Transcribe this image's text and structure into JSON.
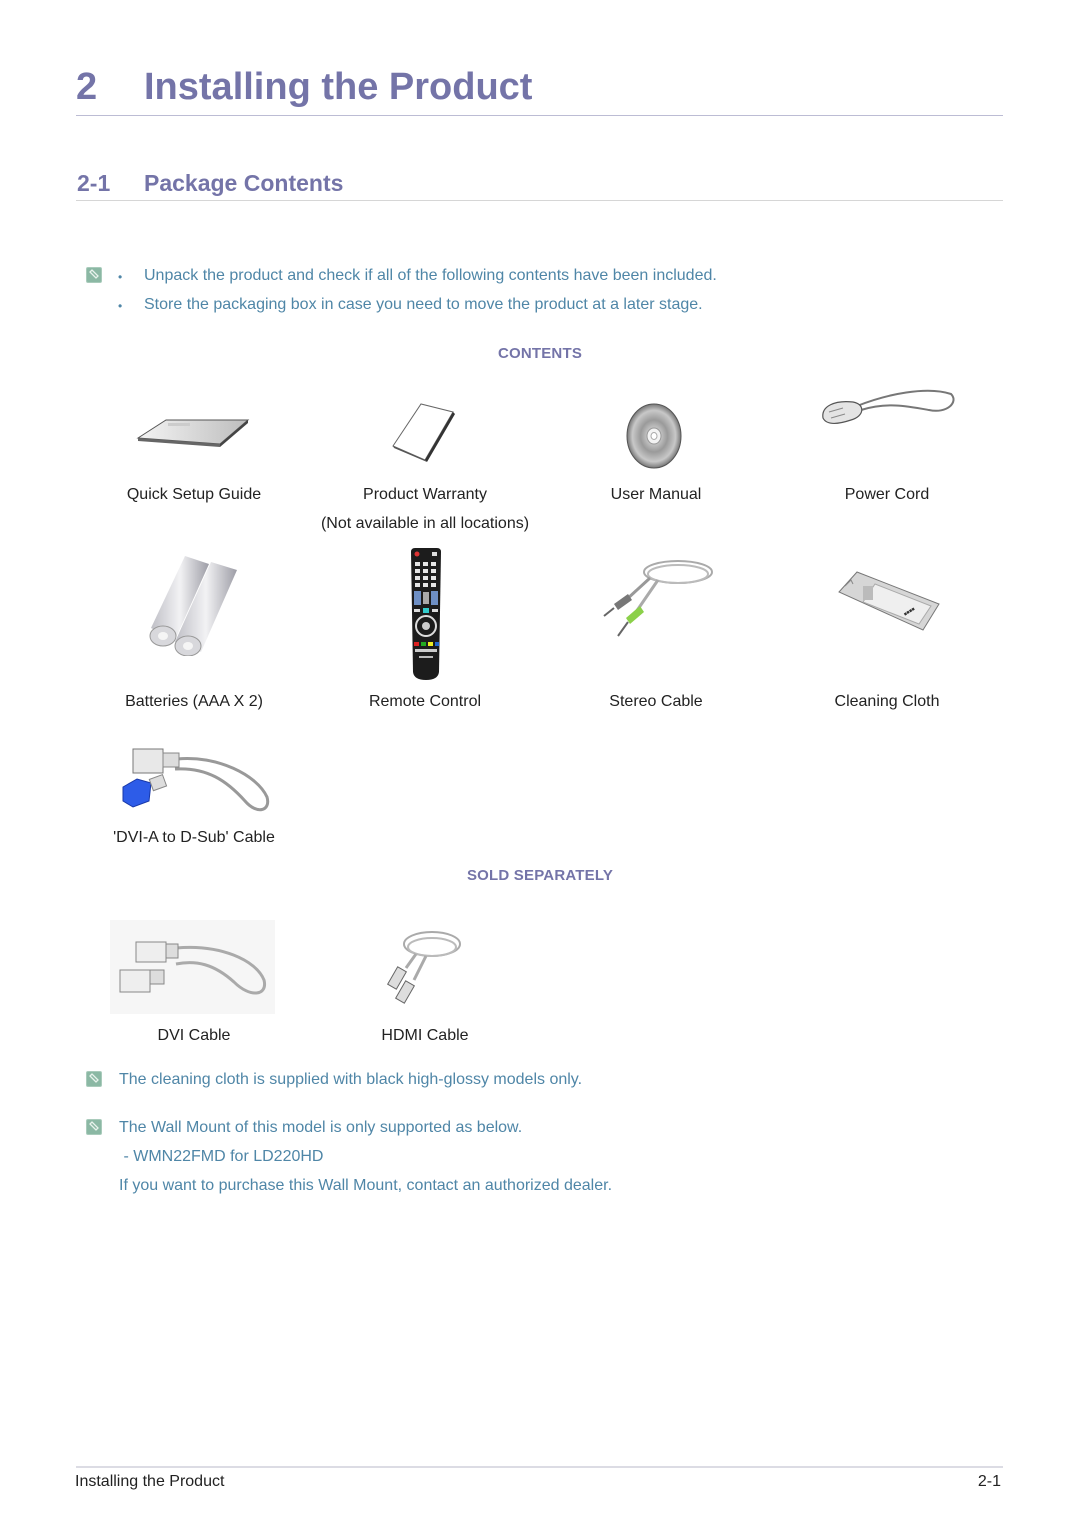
{
  "chapter": {
    "number": "2",
    "title": "Installing the Product"
  },
  "section": {
    "number": "2-1",
    "title": "Package Contents"
  },
  "intro_notes": [
    "Unpack the product and check if all of the following contents have been included.",
    "Store the packaging box in case you need to move the product at a later stage."
  ],
  "contents": {
    "heading": "CONTENTS",
    "items": [
      {
        "label": "Quick Setup Guide",
        "icon": "booklet-icon"
      },
      {
        "label": "Product Warranty",
        "sublabel": "(Not available in all locations)",
        "icon": "warranty-card-icon"
      },
      {
        "label": "User Manual",
        "icon": "cd-icon"
      },
      {
        "label": "Power Cord",
        "icon": "power-cord-icon"
      },
      {
        "label": "Batteries (AAA X 2)",
        "icon": "batteries-icon"
      },
      {
        "label": "Remote Control",
        "icon": "remote-control-icon"
      },
      {
        "label": "Stereo Cable",
        "icon": "stereo-cable-icon"
      },
      {
        "label": "Cleaning Cloth",
        "icon": "cleaning-cloth-icon"
      },
      {
        "label": "'DVI-A to D-Sub' Cable",
        "icon": "dvi-dsub-cable-icon"
      }
    ]
  },
  "sold_separately": {
    "heading": "SOLD SEPARATELY",
    "items": [
      {
        "label": "DVI Cable",
        "icon": "dvi-cable-icon"
      },
      {
        "label": "HDMI Cable",
        "icon": "hdmi-cable-icon"
      }
    ]
  },
  "notes": {
    "cleaning_cloth": "The cleaning cloth is supplied with black high-glossy models only.",
    "wall_mount_line1": "The Wall Mount of this model is only supported as below.",
    "wall_mount_line2": " - WMN22FMD for LD220HD",
    "wall_mount_line3": "If you want to purchase this Wall Mount, contact an authorized dealer."
  },
  "footer": {
    "left": "Installing the Product",
    "page": "2-1"
  },
  "colors": {
    "heading": "#7474a8",
    "note_text": "#4f86a7",
    "note_icon": "#8bb8a4"
  }
}
